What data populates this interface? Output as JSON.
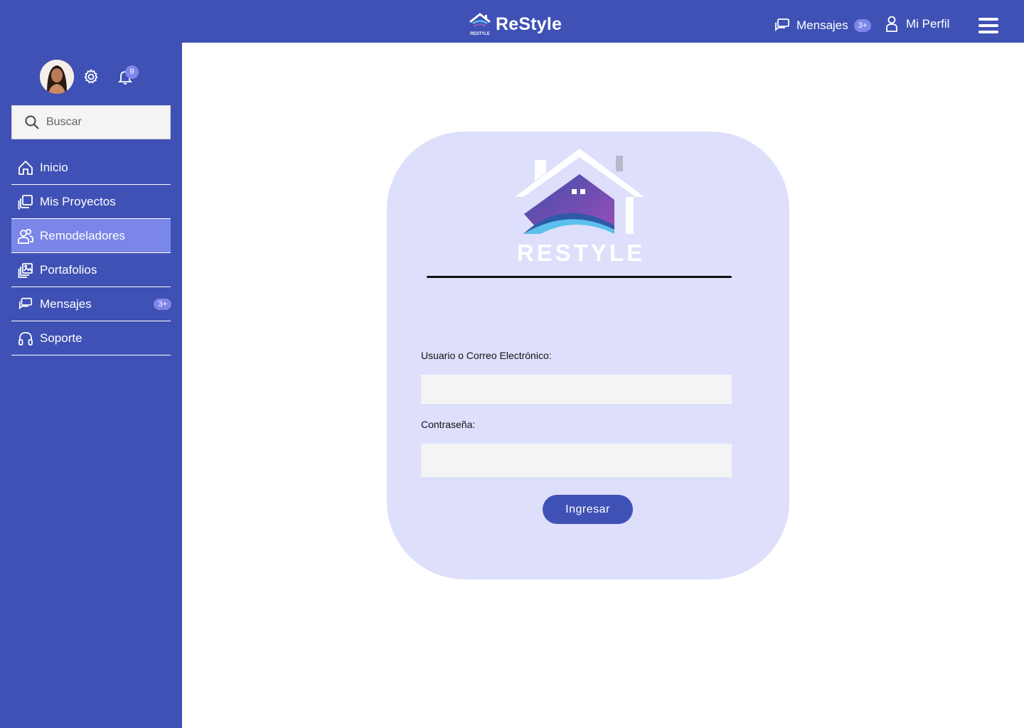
{
  "header": {
    "brand_name": "ReStyle",
    "brand_logo_text": "RESTYLE",
    "messages_label": "Mensajes",
    "messages_badge": "3+",
    "profile_label": "Mi Perfil",
    "icons": {
      "messages": "chat-icon",
      "profile": "user-icon",
      "menu": "hamburger-menu-icon"
    }
  },
  "sidebar": {
    "notifications_count": "9",
    "search_placeholder": "Buscar",
    "items": [
      {
        "label": "Inicio",
        "icon": "home-icon",
        "active": false
      },
      {
        "label": "Mis Proyectos",
        "icon": "projects-icon",
        "active": false
      },
      {
        "label": "Remodeladores",
        "icon": "users-icon",
        "active": true
      },
      {
        "label": "Portafolios",
        "icon": "portfolio-icon",
        "active": false
      },
      {
        "label": "Mensajes",
        "icon": "chat-icon",
        "active": false,
        "badge": "3+"
      },
      {
        "label": "Soporte",
        "icon": "headset-icon",
        "active": false
      }
    ]
  },
  "login": {
    "logo_text": "RESTYLE",
    "user_label": "Usuario o Correo Electrónico:",
    "user_value": "",
    "password_label": "Contraseña:",
    "password_value": "",
    "submit_label": "Ingresar"
  },
  "colors": {
    "primary": "#3f51b5",
    "active_nav": "#7a86e8",
    "badge": "#7d86e8",
    "card_bg": "#dedffb",
    "field_bg": "#f4f4f4"
  }
}
